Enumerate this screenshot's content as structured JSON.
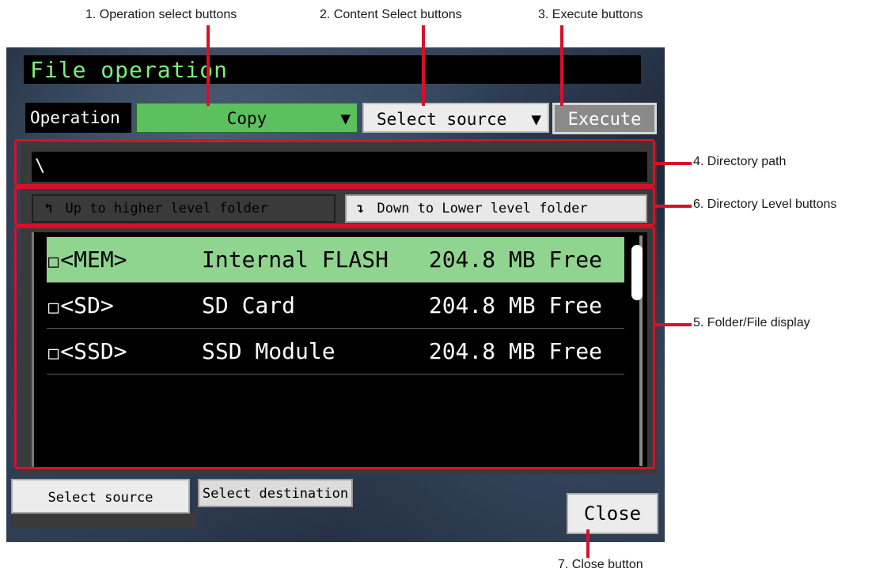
{
  "callouts": {
    "operation_select": "1. Operation select buttons",
    "content_select": "2. Content Select buttons",
    "execute": "3. Execute buttons",
    "directory_path": "4. Directory path",
    "folder_file_display": "5. Folder/File display",
    "directory_level": "6. Directory Level buttons",
    "close": "7. Close button"
  },
  "window": {
    "title": "File operation"
  },
  "toolbar": {
    "operation_label": "Operation",
    "operation_value": "Copy",
    "content_select_value": "Select source",
    "dropdown_arrow": "▼",
    "execute_label": "Execute"
  },
  "directory": {
    "path": "\\",
    "up_icon": "↰",
    "up_label": "Up to higher level folder",
    "down_icon": "↴",
    "down_label": "Down to Lower level folder"
  },
  "file_list": {
    "checkbox_glyph": "□",
    "rows": [
      {
        "name": "<MEM>",
        "description": "Internal FLASH",
        "free": "204.8 MB Free",
        "selected": true
      },
      {
        "name": "<SD>",
        "description": "SD Card",
        "free": "204.8 MB Free",
        "selected": false
      },
      {
        "name": "<SSD>",
        "description": "SSD Module",
        "free": "204.8 MB Free",
        "selected": false
      }
    ]
  },
  "tabs": {
    "source_label": "Select source",
    "destination_label": "Select destination"
  },
  "footer": {
    "close_label": "Close"
  },
  "colors": {
    "callout_red": "#d8102a",
    "title_green": "#7df07d",
    "operation_green": "#5cc05c",
    "selected_row": "#8fd48f"
  }
}
